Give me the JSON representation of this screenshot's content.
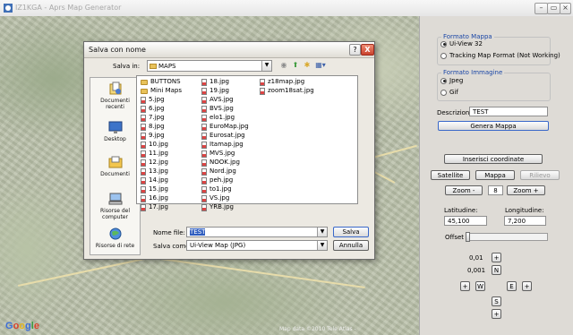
{
  "window": {
    "title": "IZ1KGA - Aprs Map Generator",
    "minimize_glyph": "▭"
  },
  "map": {
    "logo": "Google",
    "attribution": "Map data ©2010 Tele Atlas -"
  },
  "panel": {
    "formato_mappa": {
      "title": "Formato Mappa",
      "options": [
        "Ui-View 32",
        "Tracking Map Format (Not Working)"
      ],
      "selected": 0
    },
    "formato_immagine": {
      "title": "Formato Immagine",
      "options": [
        "Jpeg",
        "Gif"
      ],
      "selected": 0
    },
    "descrizione_label": "Descrizione:",
    "descrizione_value": "TEST",
    "genera_button": "Genera Mappa",
    "inserisci_button": "Inserisci coordinate",
    "view_buttons": [
      "Satellite",
      "Mappa",
      "Rilievo"
    ],
    "zoom_minus": "Zoom -",
    "zoom_value": "8",
    "zoom_plus": "Zoom +",
    "latitudine_label": "Latitudine:",
    "latitudine_value": "45,100",
    "longitudine_label": "Longitudine:",
    "longitudine_value": "7,200",
    "offset_label": "Offset",
    "offset_level": 0,
    "step1": "0,01",
    "step2": "0,001",
    "nav": {
      "n": "N",
      "w": "W",
      "e": "E",
      "s": "S",
      "plus": "+"
    }
  },
  "dialog": {
    "title": "Salva con nome",
    "help_glyph": "?",
    "close_glyph": "X",
    "salva_in_label": "Salva in:",
    "salva_in_value": "MAPS",
    "places": [
      "Documenti recenti",
      "Desktop",
      "Documenti",
      "Risorse del computer",
      "Risorse di rete"
    ],
    "files_col1": [
      {
        "name": "BUTTONS",
        "type": "folder"
      },
      {
        "name": "Mini Maps",
        "type": "folder"
      },
      {
        "name": "5.jpg",
        "type": "jpg"
      },
      {
        "name": "6.jpg",
        "type": "jpg"
      },
      {
        "name": "7.jpg",
        "type": "jpg"
      },
      {
        "name": "8.jpg",
        "type": "jpg"
      },
      {
        "name": "9.jpg",
        "type": "jpg"
      },
      {
        "name": "10.jpg",
        "type": "jpg"
      },
      {
        "name": "11.jpg",
        "type": "jpg"
      },
      {
        "name": "12.jpg",
        "type": "jpg"
      },
      {
        "name": "13.jpg",
        "type": "jpg"
      },
      {
        "name": "14.jpg",
        "type": "jpg"
      },
      {
        "name": "15.jpg",
        "type": "jpg"
      },
      {
        "name": "16.jpg",
        "type": "jpg"
      },
      {
        "name": "17.jpg",
        "type": "jpg"
      }
    ],
    "files_col2": [
      {
        "name": "18.jpg",
        "type": "jpg"
      },
      {
        "name": "19.jpg",
        "type": "jpg"
      },
      {
        "name": "AVS.jpg",
        "type": "jpg"
      },
      {
        "name": "BVS.jpg",
        "type": "jpg"
      },
      {
        "name": "elo1.jpg",
        "type": "jpg"
      },
      {
        "name": "EuroMap.jpg",
        "type": "jpg"
      },
      {
        "name": "Eurosat.jpg",
        "type": "jpg"
      },
      {
        "name": "Itamap.jpg",
        "type": "jpg"
      },
      {
        "name": "MVS.jpg",
        "type": "jpg"
      },
      {
        "name": "NOOK.jpg",
        "type": "jpg"
      },
      {
        "name": "Nord.jpg",
        "type": "jpg"
      },
      {
        "name": "peh.jpg",
        "type": "jpg"
      },
      {
        "name": "to1.jpg",
        "type": "jpg"
      },
      {
        "name": "VS.jpg",
        "type": "jpg"
      },
      {
        "name": "YRB.jpg",
        "type": "jpg"
      }
    ],
    "files_col3": [
      {
        "name": "z18map.jpg",
        "type": "jpg"
      },
      {
        "name": "zoom18sat.jpg",
        "type": "jpg"
      }
    ],
    "nome_file_label": "Nome file:",
    "nome_file_value": "TEST",
    "salva_come_label": "Salva come:",
    "salva_come_value": "Ui-View Map (JPG)",
    "salva_button": "Salva",
    "annulla_button": "Annulla"
  }
}
